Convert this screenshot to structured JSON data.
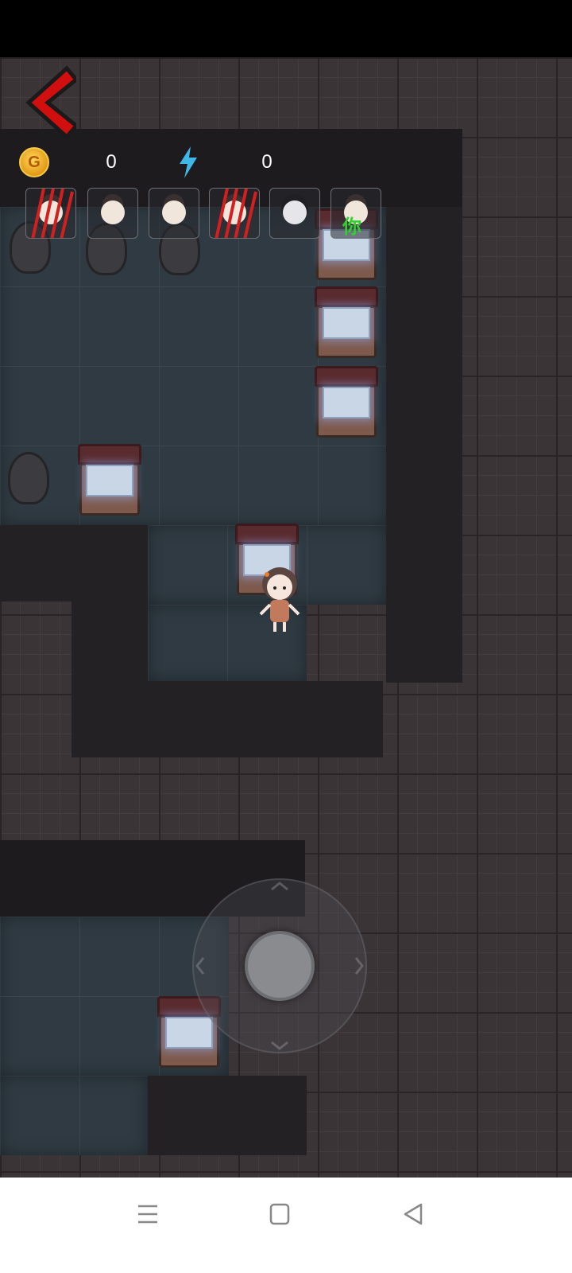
{
  "hud": {
    "coin_symbol": "G",
    "coin_count": "0",
    "energy_count": "0"
  },
  "players": [
    {
      "name": "slot-1",
      "state": "clawed"
    },
    {
      "name": "slot-2",
      "state": "alive"
    },
    {
      "name": "slot-3",
      "state": "alive"
    },
    {
      "name": "slot-4",
      "state": "clawed"
    },
    {
      "name": "slot-5",
      "state": "ghost"
    },
    {
      "name": "slot-6",
      "state": "self"
    }
  ],
  "self_label": "你",
  "colors": {
    "back_arrow": "#d10f0f",
    "energy_bolt": "#3fb7e8",
    "self_label": "#2fd12c",
    "claw": "#d41f1f"
  },
  "navbar": {
    "menu_icon": "menu-icon",
    "home_icon": "home-icon",
    "back_icon": "back-icon"
  }
}
